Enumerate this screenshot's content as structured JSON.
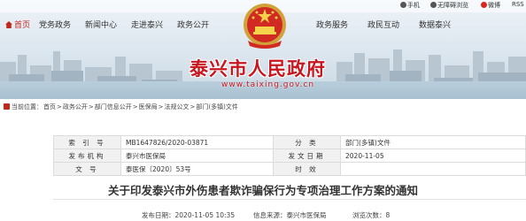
{
  "topbar": {
    "mobile": "手机",
    "accessible": "无障碍浏览",
    "weibo": "微博",
    "rss": "RSS"
  },
  "nav_left": [
    "首页",
    "党务政务",
    "新闻中心",
    "走进泰兴",
    "政务公开"
  ],
  "nav_right": [
    "政务服务",
    "政民互动",
    "数据泰兴"
  ],
  "site": {
    "name": "泰兴市人民政府",
    "url": "www.taixing.gov.cn"
  },
  "breadcrumb": {
    "label": "当前位置：",
    "items": [
      "首页",
      "政务公开",
      "部门信息公开",
      "医保局",
      "法规公文",
      "部门(多镇)文件"
    ],
    "separator": ">"
  },
  "meta": {
    "index_label": "索 引 号",
    "index_value": "MB1647826/2020-03871",
    "category_label": "分 类",
    "category_value": "部门(多镇)文件",
    "publisher_label": "发布机构",
    "publisher_value": "泰兴市医保局",
    "date_label": "发文日期",
    "date_value": "2020-11-05",
    "docno_label": "文 号",
    "docno_value": "泰医保〔2020〕53号",
    "validity_label": "时 效",
    "validity_value": ""
  },
  "article": {
    "title": "关于印发泰兴市外伤患者欺诈骗保行为专项治理工作方案的通知",
    "publish_label": "发布日期：",
    "publish_value": "2020-11-05 10:35",
    "source_label": "信息来源：",
    "source_value": "泰兴市医保局",
    "views_label": "浏览次数：",
    "views_value": "8"
  },
  "colors": {
    "brand_red": "#c8161e",
    "nav_active": "#c2271d"
  }
}
